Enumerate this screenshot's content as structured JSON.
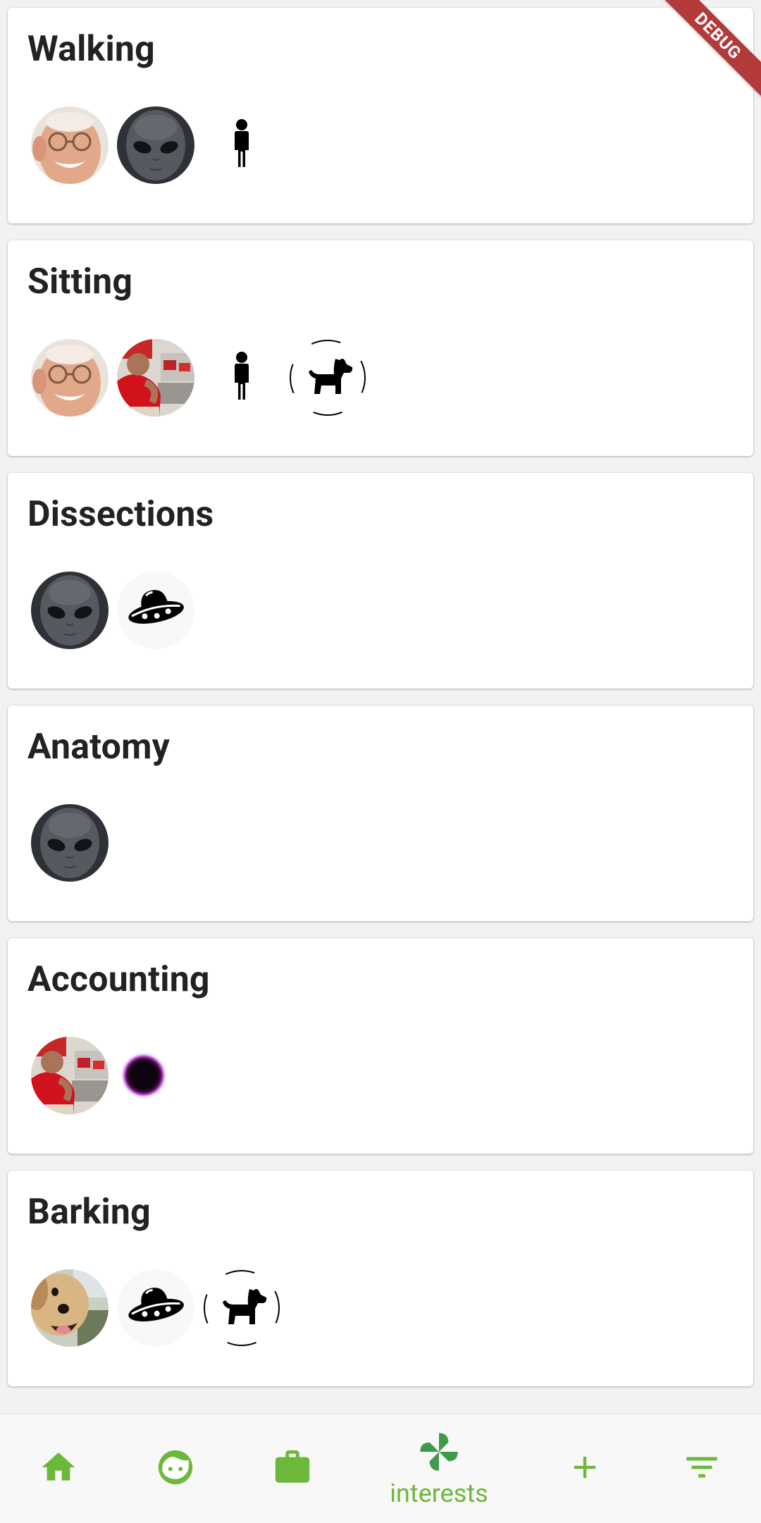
{
  "debug_banner": "DEBUG",
  "interests": [
    {
      "title": "Walking",
      "members": [
        "old-man-avatar",
        "alien-avatar",
        "person-icon"
      ]
    },
    {
      "title": "Sitting",
      "members": [
        "old-man-avatar",
        "red-sweater-man-avatar",
        "person-icon",
        "dog-icon"
      ]
    },
    {
      "title": "Dissections",
      "members": [
        "alien-avatar",
        "ufo-icon"
      ]
    },
    {
      "title": "Anatomy",
      "members": [
        "alien-avatar"
      ]
    },
    {
      "title": "Accounting",
      "members": [
        "red-sweater-man-avatar",
        "black-hole-avatar"
      ]
    },
    {
      "title": "Barking",
      "members": [
        "dog-photo-avatar",
        "ufo-icon",
        "dog-icon"
      ]
    }
  ],
  "bottom_nav": {
    "items": [
      {
        "icon": "home-icon"
      },
      {
        "icon": "face-icon"
      },
      {
        "icon": "briefcase-icon"
      },
      {
        "icon": "pinwheel-icon",
        "label": "interests",
        "active": true
      },
      {
        "icon": "add-icon"
      },
      {
        "icon": "filter-icon"
      }
    ]
  },
  "colors": {
    "accent": "#6bb83a",
    "active_icon": "#3f9b4a",
    "debug_ribbon": "#b43a3a",
    "title_text": "#222222"
  }
}
